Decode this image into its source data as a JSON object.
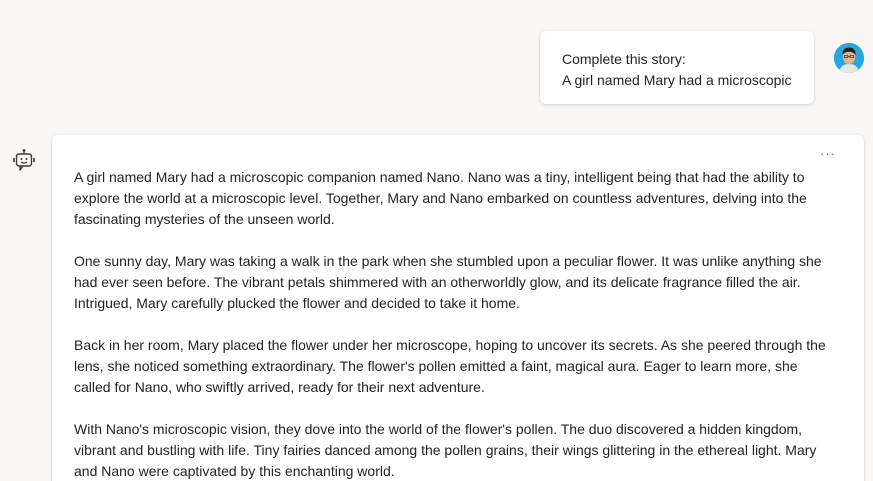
{
  "user_message": {
    "lines": [
      "Complete this story:",
      "A girl named Mary had a microscopic"
    ]
  },
  "user_avatar": {
    "icon": "user-avatar-icon"
  },
  "bot": {
    "icon": "bot-icon",
    "more_label": "···",
    "paragraphs": [
      "A girl named Mary had a microscopic companion named Nano. Nano was a tiny, intelligent being that had the ability to explore the world at a microscopic level. Together, Mary and Nano embarked on countless adventures, delving into the fascinating mysteries of the unseen world.",
      "One sunny day, Mary was taking a walk in the park when she stumbled upon a peculiar flower. It was unlike anything she had ever seen before. The vibrant petals shimmered with an otherworldly glow, and its delicate fragrance filled the air. Intrigued, Mary carefully plucked the flower and decided to take it home.",
      "Back in her room, Mary placed the flower under her microscope, hoping to uncover its secrets. As she peered through the lens, she noticed something extraordinary. The flower's pollen emitted a faint, magical aura. Eager to learn more, she called for Nano, who swiftly arrived, ready for their next adventure.",
      "With Nano's microscopic vision, they dove into the world of the flower's pollen. The duo discovered a hidden kingdom, vibrant and bustling with life. Tiny fairies danced among the pollen grains, their wings glittering in the ethereal light. Mary and Nano were captivated by this enchanting world."
    ]
  },
  "colors": {
    "background": "#f8f7f5",
    "card": "#ffffff",
    "text": "#242424",
    "avatar_bg": "#29a8dd"
  }
}
